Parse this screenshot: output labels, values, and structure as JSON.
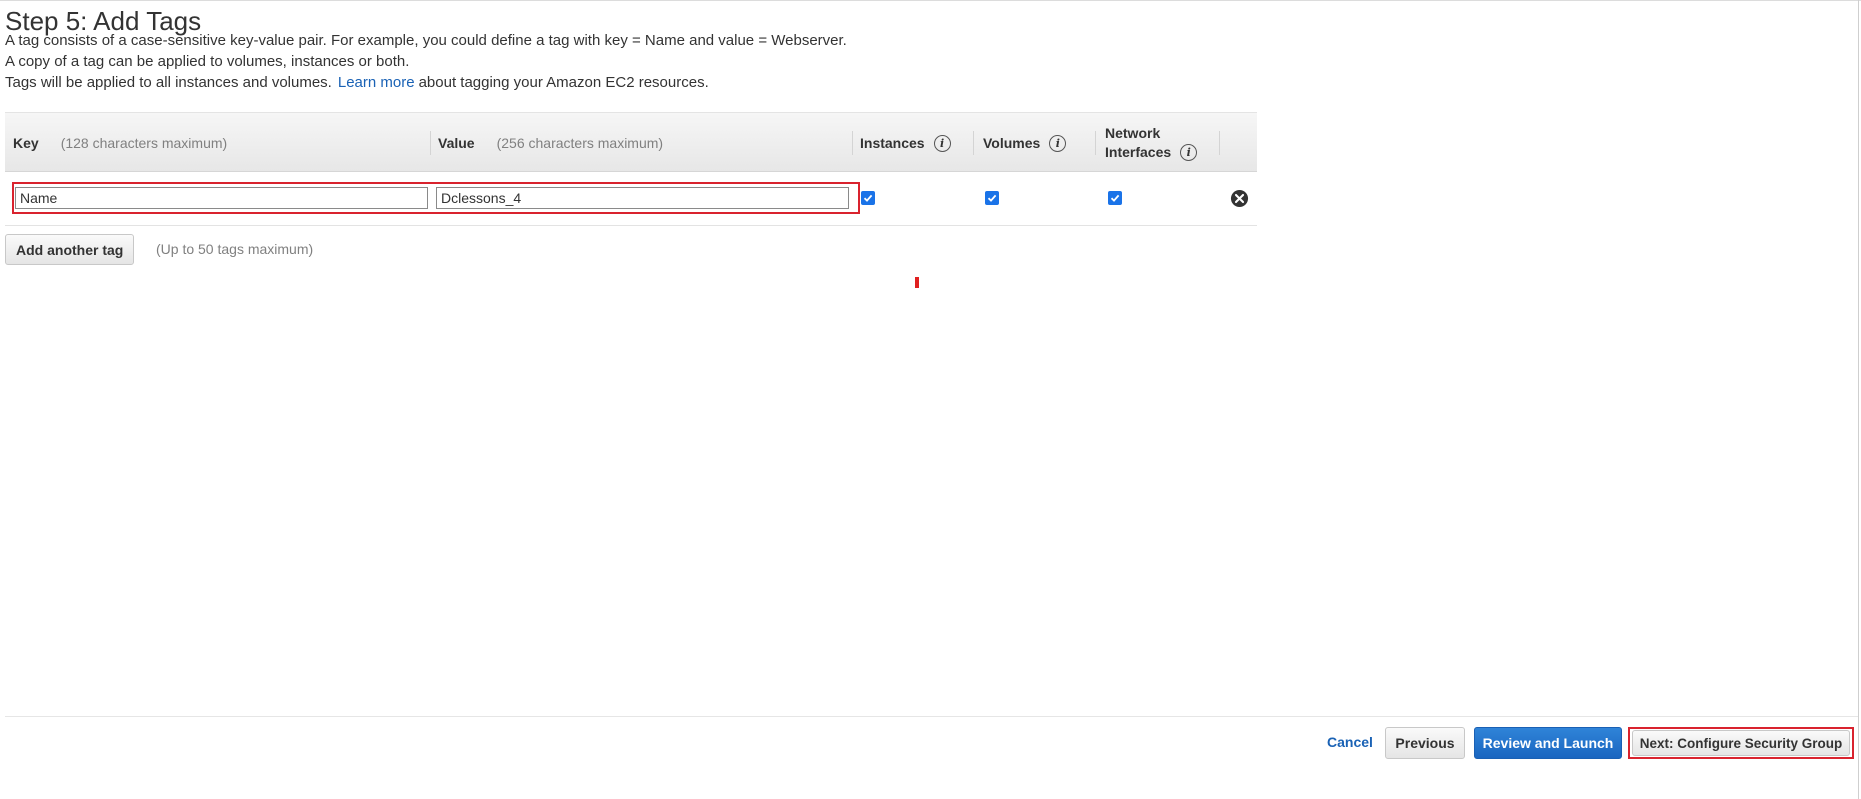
{
  "page": {
    "title": "Step 5: Add Tags",
    "desc_line1": "A tag consists of a case-sensitive key-value pair. For example, you could define a tag with key = Name and value = Webserver.",
    "desc_line2": "A copy of a tag can be applied to volumes, instances or both.",
    "desc_line3_pre": "Tags will be applied to all instances and volumes.",
    "learn_more": "Learn more",
    "desc_line3_post": "about tagging your Amazon EC2 resources."
  },
  "table": {
    "headers": {
      "key": "Key",
      "key_hint": "(128 characters maximum)",
      "value": "Value",
      "value_hint": "(256 characters maximum)",
      "instances": "Instances",
      "volumes": "Volumes",
      "network_line1": "Network",
      "network_line2": "Interfaces"
    },
    "rows": [
      {
        "key": "Name",
        "value": "Dclessons_4",
        "instances": true,
        "volumes": true,
        "network_interfaces": true
      }
    ]
  },
  "actions": {
    "add_tag": "Add another tag",
    "add_tag_note": "(Up to 50 tags maximum)"
  },
  "footer": {
    "cancel": "Cancel",
    "previous": "Previous",
    "review": "Review and Launch",
    "next": "Next: Configure Security Group"
  },
  "icons": {
    "info": "info-icon",
    "remove": "close-circle-icon",
    "check": "check-icon"
  },
  "colors": {
    "link": "#1a62b5",
    "primary_button": "#1a66c0",
    "highlight": "#d9232e",
    "checkbox": "#1a73e8"
  }
}
